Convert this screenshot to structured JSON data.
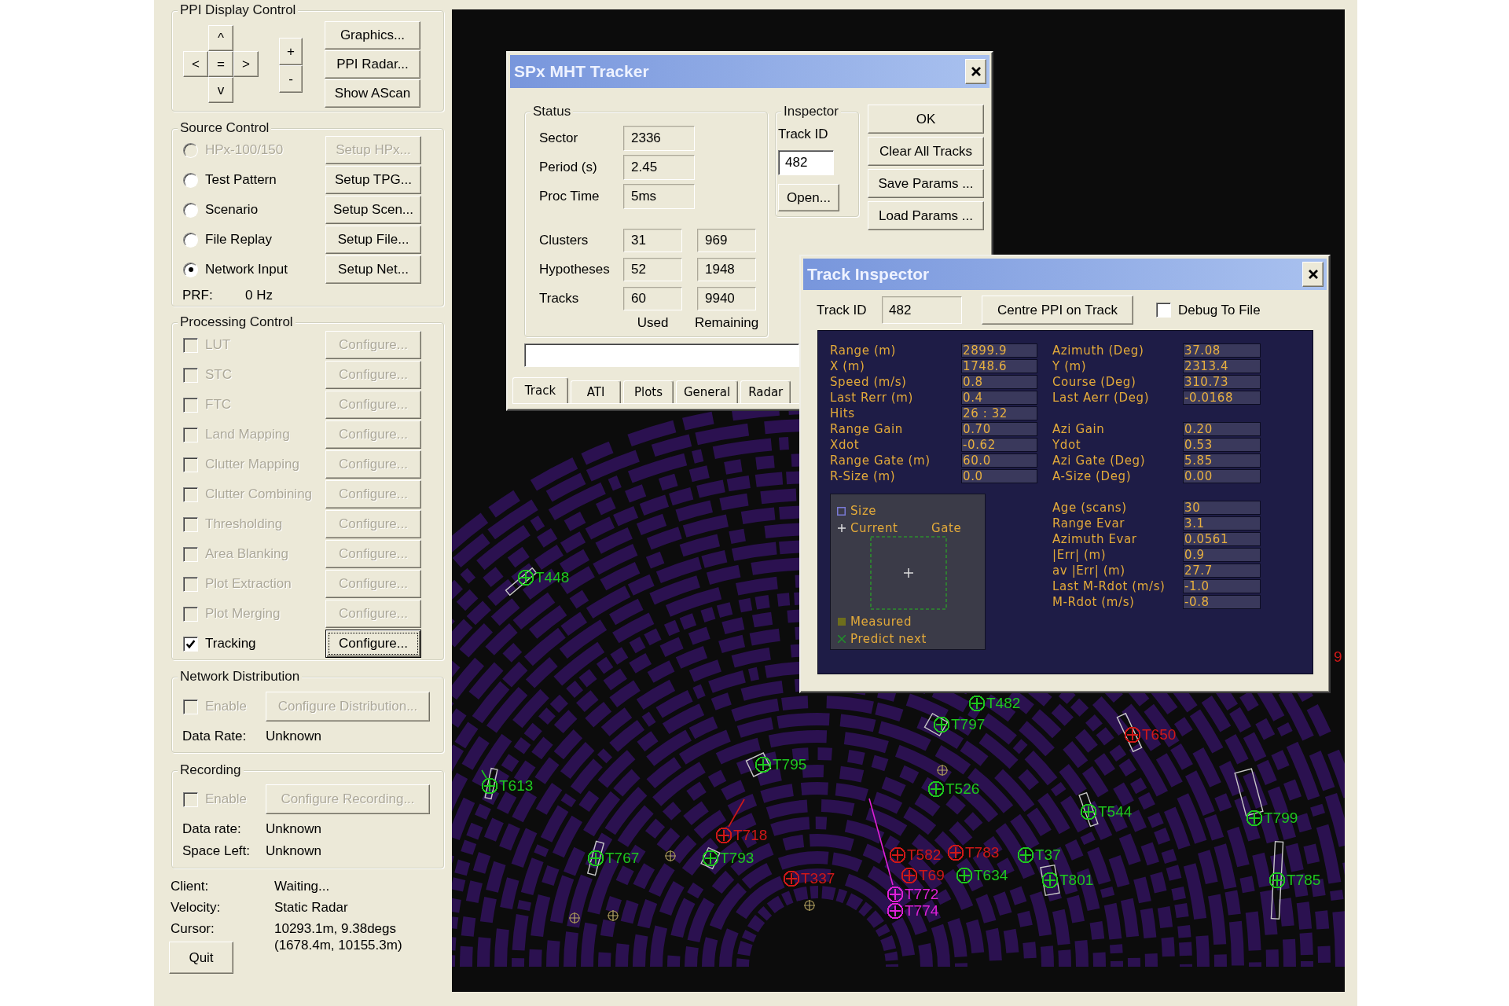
{
  "ppi_display_control": {
    "title": "PPI Display Control",
    "pan_pad": [
      "^",
      "<",
      "=",
      ">",
      "v"
    ],
    "zoom_buttons": [
      "+",
      "-"
    ],
    "buttons": [
      "Graphics...",
      "PPI Radar...",
      "Show AScan"
    ]
  },
  "source_control": {
    "title": "Source Control",
    "sources": [
      {
        "label": "HPx-100/150",
        "selected": false,
        "disabled": true,
        "button": "Setup HPx...",
        "button_disabled": true
      },
      {
        "label": "Test Pattern",
        "selected": false,
        "disabled": false,
        "button": "Setup TPG...",
        "button_disabled": false
      },
      {
        "label": "Scenario",
        "selected": false,
        "disabled": false,
        "button": "Setup Scen...",
        "button_disabled": false
      },
      {
        "label": "File Replay",
        "selected": false,
        "disabled": false,
        "button": "Setup File...",
        "button_disabled": false
      },
      {
        "label": "Network Input",
        "selected": true,
        "disabled": false,
        "button": "Setup Net...",
        "button_disabled": false
      }
    ],
    "prf_label": "PRF:",
    "prf_value": "0 Hz"
  },
  "processing_control": {
    "title": "Processing Control",
    "stages": [
      {
        "label": "LUT",
        "checked": false,
        "disabled": true,
        "button": "Configure...",
        "button_disabled": true,
        "focused": false
      },
      {
        "label": "STC",
        "checked": false,
        "disabled": true,
        "button": "Configure...",
        "button_disabled": true,
        "focused": false
      },
      {
        "label": "FTC",
        "checked": false,
        "disabled": true,
        "button": "Configure...",
        "button_disabled": true,
        "focused": false
      },
      {
        "label": "Land Mapping",
        "checked": false,
        "disabled": true,
        "button": "Configure...",
        "button_disabled": true,
        "focused": false
      },
      {
        "label": "Clutter Mapping",
        "checked": false,
        "disabled": true,
        "button": "Configure...",
        "button_disabled": true,
        "focused": false
      },
      {
        "label": "Clutter Combining",
        "checked": false,
        "disabled": true,
        "button": "Configure...",
        "button_disabled": true,
        "focused": false
      },
      {
        "label": "Thresholding",
        "checked": false,
        "disabled": true,
        "button": "Configure...",
        "button_disabled": true,
        "focused": false
      },
      {
        "label": "Area Blanking",
        "checked": false,
        "disabled": true,
        "button": "Configure...",
        "button_disabled": true,
        "focused": false
      },
      {
        "label": "Plot Extraction",
        "checked": false,
        "disabled": true,
        "button": "Configure...",
        "button_disabled": true,
        "focused": false
      },
      {
        "label": "Plot Merging",
        "checked": false,
        "disabled": true,
        "button": "Configure...",
        "button_disabled": true,
        "focused": false
      },
      {
        "label": "Tracking",
        "checked": true,
        "disabled": false,
        "button": "Configure...",
        "button_disabled": false,
        "focused": true
      }
    ]
  },
  "network_distribution": {
    "title": "Network Distribution",
    "enable": {
      "label": "Enable",
      "checked": false,
      "disabled": true
    },
    "button": {
      "label": "Configure Distribution...",
      "disabled": true
    },
    "fields": [
      {
        "label": "Data Rate:",
        "value": "Unknown"
      }
    ]
  },
  "recording": {
    "title": "Recording",
    "enable": {
      "label": "Enable",
      "checked": false,
      "disabled": true
    },
    "button": {
      "label": "Configure Recording...",
      "disabled": true
    },
    "fields": [
      {
        "label": "Data rate:",
        "value": "Unknown"
      },
      {
        "label": "Space Left:",
        "value": "Unknown"
      }
    ]
  },
  "status": [
    {
      "label": "Client:",
      "value": "Waiting..."
    },
    {
      "label": "Velocity:",
      "value": "Static Radar"
    },
    {
      "label": "Cursor:",
      "value": "10293.1m, 9.38degs\n(1678.4m, 10155.3m)"
    }
  ],
  "quit_button": "Quit",
  "radar": {
    "tracks": [
      {
        "label": "T448",
        "color": "#1ec81e"
      },
      {
        "label": "9",
        "color": "#d01818"
      },
      {
        "label": "T482",
        "color": "#1ec81e"
      },
      {
        "label": "T797",
        "color": "#1ec81e"
      },
      {
        "label": "T650",
        "color": "#d01818"
      },
      {
        "label": "T795",
        "color": "#1ec81e"
      },
      {
        "label": "T613",
        "color": "#1ec81e"
      },
      {
        "label": "T526",
        "color": "#1ec81e"
      },
      {
        "label": "T544",
        "color": "#1ec81e"
      },
      {
        "label": "T799",
        "color": "#1ec81e"
      },
      {
        "label": "T718",
        "color": "#d01818"
      },
      {
        "label": "T767",
        "color": "#1ec81e"
      },
      {
        "label": "T793",
        "color": "#1ec81e"
      },
      {
        "label": "T582",
        "color": "#d01818"
      },
      {
        "label": "T783",
        "color": "#d01818"
      },
      {
        "label": "T37",
        "color": "#1ec81e"
      },
      {
        "label": "T337",
        "color": "#d01818"
      },
      {
        "label": "T69",
        "color": "#d01818"
      },
      {
        "label": "T634",
        "color": "#1ec81e"
      },
      {
        "label": "T801",
        "color": "#1ec81e"
      },
      {
        "label": "T785",
        "color": "#1ec81e"
      },
      {
        "label": "T772",
        "color": "#e020d8"
      },
      {
        "label": "T774",
        "color": "#e020d8"
      }
    ]
  },
  "mht_tracker": {
    "title": "SPx MHT Tracker",
    "status": {
      "title": "Status",
      "rows": [
        {
          "label": "Sector",
          "values": [
            "2336"
          ]
        },
        {
          "label": "Period (s)",
          "values": [
            "2.45"
          ]
        },
        {
          "label": "Proc Time",
          "values": [
            "5ms"
          ]
        },
        {
          "label": "Clusters",
          "values": [
            "31",
            "969"
          ]
        },
        {
          "label": "Hypotheses",
          "values": [
            "52",
            "1948"
          ]
        },
        {
          "label": "Tracks",
          "values": [
            "60",
            "9940"
          ]
        }
      ],
      "column_labels": [
        "Used",
        "Remaining"
      ]
    },
    "inspector": {
      "title": "Inspector",
      "track_id_label": "Track ID",
      "track_id": "482",
      "open_button": "Open..."
    },
    "buttons": [
      "OK",
      "Clear All Tracks",
      "Save Params ...",
      "Load Params ..."
    ],
    "tabs": [
      {
        "label": "Track",
        "selected": true
      },
      {
        "label": "ATI",
        "selected": false
      },
      {
        "label": "Plots",
        "selected": false
      },
      {
        "label": "General",
        "selected": false
      },
      {
        "label": "Radar",
        "selected": false
      }
    ]
  },
  "track_inspector": {
    "title": "Track Inspector",
    "track_id_label": "Track ID",
    "track_id": "482",
    "centre_button": "Centre PPI on Track",
    "debug": {
      "label": "Debug To File",
      "checked": false
    },
    "left_fields": [
      {
        "label": "Range (m)",
        "value": "2899.9"
      },
      {
        "label": "X (m)",
        "value": "1748.6"
      },
      {
        "label": "Speed (m/s)",
        "value": "0.8"
      },
      {
        "label": "Last Rerr (m)",
        "value": "0.4"
      },
      {
        "label": "Hits",
        "value": "26 : 32"
      },
      {
        "label": "Range Gain",
        "value": "0.70"
      },
      {
        "label": "Xdot",
        "value": "-0.62"
      },
      {
        "label": "Range Gate (m)",
        "value": "60.0"
      },
      {
        "label": "R-Size (m)",
        "value": "0.0"
      }
    ],
    "right_fields": [
      {
        "label": "Azimuth (Deg)",
        "value": "37.08"
      },
      {
        "label": "Y (m)",
        "value": "2313.4"
      },
      {
        "label": "Course (Deg)",
        "value": "310.73"
      },
      {
        "label": "Last Aerr (Deg)",
        "value": "-0.0168"
      },
      {
        "label": "Azi Gain",
        "value": "0.20"
      },
      {
        "label": "Ydot",
        "value": "0.53"
      },
      {
        "label": "Azi Gate (Deg)",
        "value": "5.85"
      },
      {
        "label": "A-Size (Deg)",
        "value": "0.00"
      }
    ],
    "extra_fields": [
      {
        "label": "Age (scans)",
        "value": "30"
      },
      {
        "label": "Range Evar",
        "value": "3.1"
      },
      {
        "label": "Azimuth Evar",
        "value": "0.0561"
      },
      {
        "label": "|Err| (m)",
        "value": "0.9"
      },
      {
        "label": "av |Err| (m)",
        "value": "27.7"
      },
      {
        "label": "Last M-Rdot (m/s)",
        "value": "-1.0"
      },
      {
        "label": "M-Rdot (m/s)",
        "value": "-0.8"
      }
    ],
    "legend": [
      {
        "kind": "size",
        "label": "Size"
      },
      {
        "kind": "current",
        "label": "Current"
      },
      {
        "kind": "gate",
        "label": "Gate"
      },
      {
        "kind": "measured",
        "label": "Measured"
      },
      {
        "kind": "predict",
        "label": "Predict next"
      }
    ]
  }
}
